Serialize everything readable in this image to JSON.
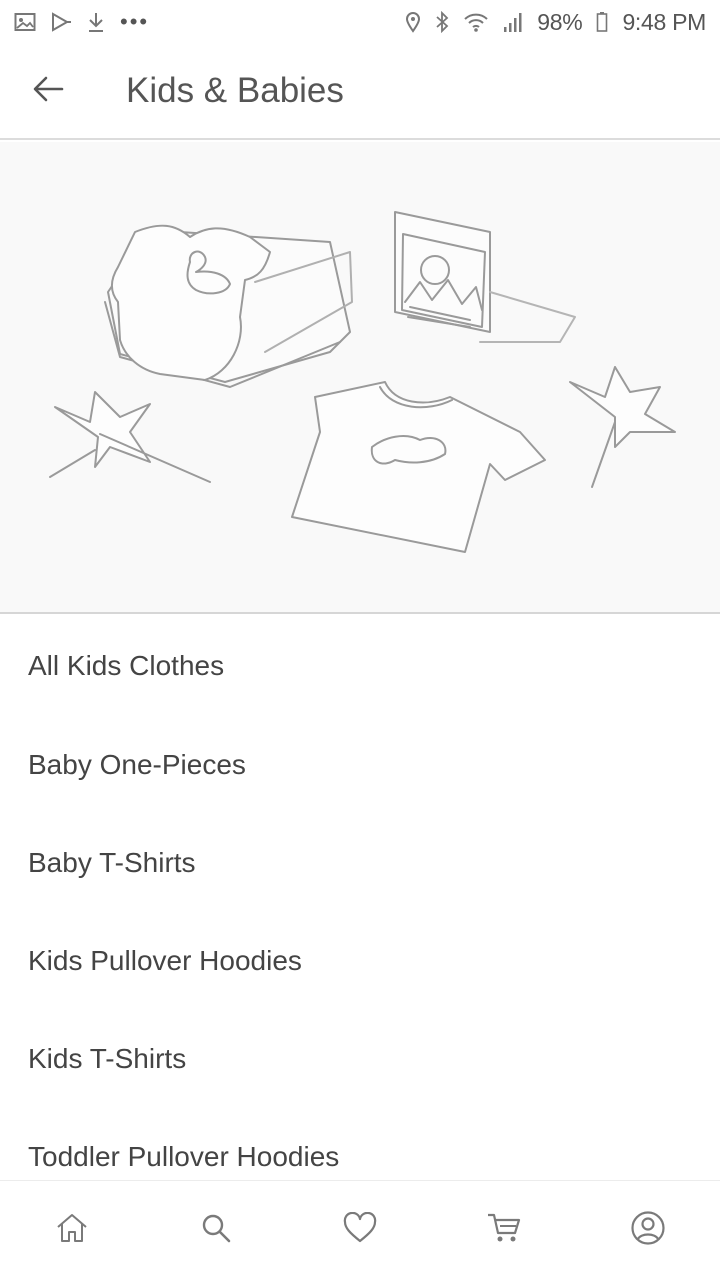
{
  "status_bar": {
    "left_icons": [
      "gallery-icon",
      "play-store-icon",
      "download-icon"
    ],
    "more_dots": "•••",
    "right_icons": [
      "location-icon",
      "bluetooth-icon",
      "wifi-icon",
      "signal-icon"
    ],
    "battery": "98%",
    "time": "9:48 PM"
  },
  "app_bar": {
    "back_icon": "arrow-left-icon",
    "title": "Kids & Babies"
  },
  "banner": {
    "image": "kids-clothes-banner"
  },
  "categories": [
    {
      "label": "All Kids Clothes"
    },
    {
      "label": "Baby One-Pieces"
    },
    {
      "label": "Baby T-Shirts"
    },
    {
      "label": "Kids Pullover Hoodies"
    },
    {
      "label": "Kids T-Shirts"
    },
    {
      "label": "Toddler Pullover Hoodies"
    }
  ],
  "bottom_nav": [
    {
      "name": "home",
      "icon": "home-icon"
    },
    {
      "name": "search",
      "icon": "search-icon"
    },
    {
      "name": "favorites",
      "icon": "heart-icon"
    },
    {
      "name": "cart",
      "icon": "cart-icon"
    },
    {
      "name": "account",
      "icon": "account-icon"
    }
  ],
  "colors": {
    "text": "#444444",
    "icon": "#7a7a7a",
    "divider": "#dcdcdc",
    "banner_bg": "#f9f9f9"
  }
}
